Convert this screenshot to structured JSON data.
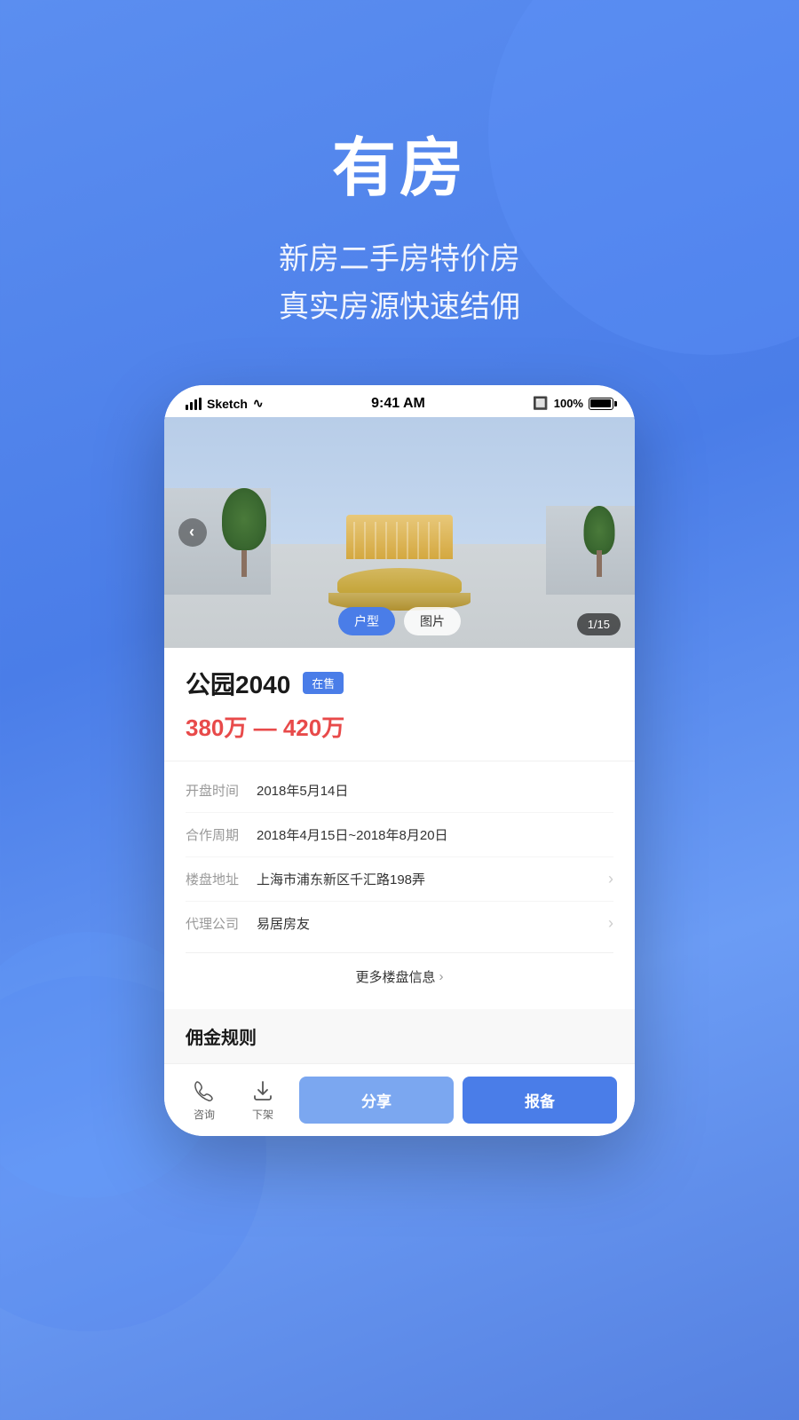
{
  "header": {
    "title": "有房",
    "subtitle_line1": "新房二手房特价房",
    "subtitle_line2": "真实房源快速结佣"
  },
  "status_bar": {
    "carrier": "Sketch",
    "wifi": "WiFi",
    "time": "9:41 AM",
    "bluetooth": "bluetooth",
    "battery": "100%"
  },
  "property": {
    "image_counter": "1/15",
    "image_btn_floor": "户型",
    "image_btn_photos": "图片",
    "name": "公园2040",
    "status_tag": "在售",
    "price": "380万 — 420万",
    "open_date_label": "开盘时间",
    "open_date_value": "2018年5月14日",
    "coop_period_label": "合作周期",
    "coop_period_value": "2018年4月15日~2018年8月20日",
    "address_label": "楼盘地址",
    "address_value": "上海市浦东新区千汇路198弄",
    "agent_label": "代理公司",
    "agent_value": "易居房友",
    "more_info_text": "更多楼盘信息",
    "commission_title": "佣金规则"
  },
  "bottom_bar": {
    "consult_label": "咨询",
    "delist_label": "下架",
    "share_label": "分享",
    "report_label": "报备"
  }
}
